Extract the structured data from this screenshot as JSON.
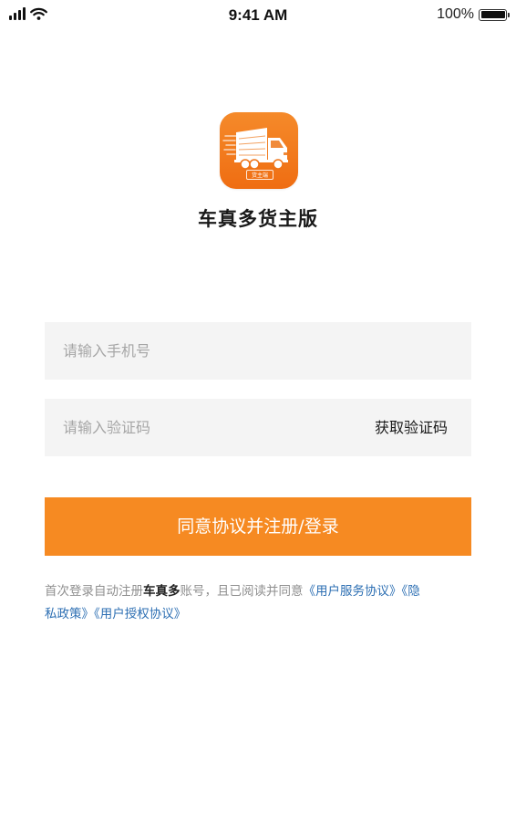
{
  "status_bar": {
    "time": "9:41 AM",
    "battery_percent": "100%"
  },
  "app": {
    "logo_tag": "货主端",
    "title": "车真多货主版"
  },
  "form": {
    "phone_placeholder": "请输入手机号",
    "code_placeholder": "请输入验证码",
    "get_code_label": "获取验证码",
    "submit_label": "同意协议并注册/登录"
  },
  "agreement": {
    "prefix": "首次登录自动注册",
    "brand": "车真多",
    "middle": "账号，且已阅读并同意",
    "link_service": "《用户服务协议》",
    "link_privacy": "《隐私政策》",
    "link_auth": "《用户授权协议》"
  },
  "colors": {
    "accent": "#f68a22",
    "link": "#2d6fb3",
    "field_bg": "#f4f4f4"
  },
  "icons": [
    "cellular-signal-icon",
    "wifi-icon",
    "battery-icon",
    "truck-icon"
  ]
}
